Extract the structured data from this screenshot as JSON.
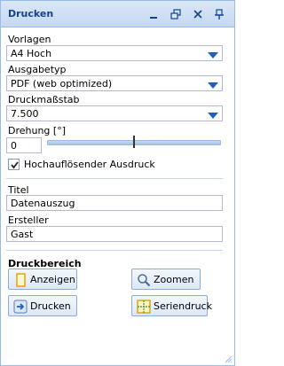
{
  "window": {
    "title": "Drucken",
    "tools": [
      "minimize-icon",
      "restore-icon",
      "close-icon",
      "pin-icon"
    ]
  },
  "form": {
    "vorlagen": {
      "label": "Vorlagen",
      "value": "A4 Hoch"
    },
    "ausgabetyp": {
      "label": "Ausgabetyp",
      "value": "PDF (web optimized)"
    },
    "massstab": {
      "label": "Druckmaßstab",
      "value": "7.500"
    },
    "drehung": {
      "label": "Drehung [°]",
      "value": "0",
      "slider_fraction": 0.5
    },
    "hires": {
      "label": "Hochauflösender Ausdruck",
      "checked": true
    },
    "titel": {
      "label": "Titel",
      "value": "Datenauszug"
    },
    "ersteller": {
      "label": "Ersteller",
      "value": "Gast"
    }
  },
  "druckbereich": {
    "title": "Druckbereich",
    "buttons": {
      "anzeigen": "Anzeigen",
      "zoomen": "Zoomen",
      "drucken": "Drucken",
      "seriendruck": "Seriendruck"
    }
  },
  "colors": {
    "title_text": "#15428b",
    "border": "#99bbe8",
    "accent": "#1f5fbf"
  }
}
